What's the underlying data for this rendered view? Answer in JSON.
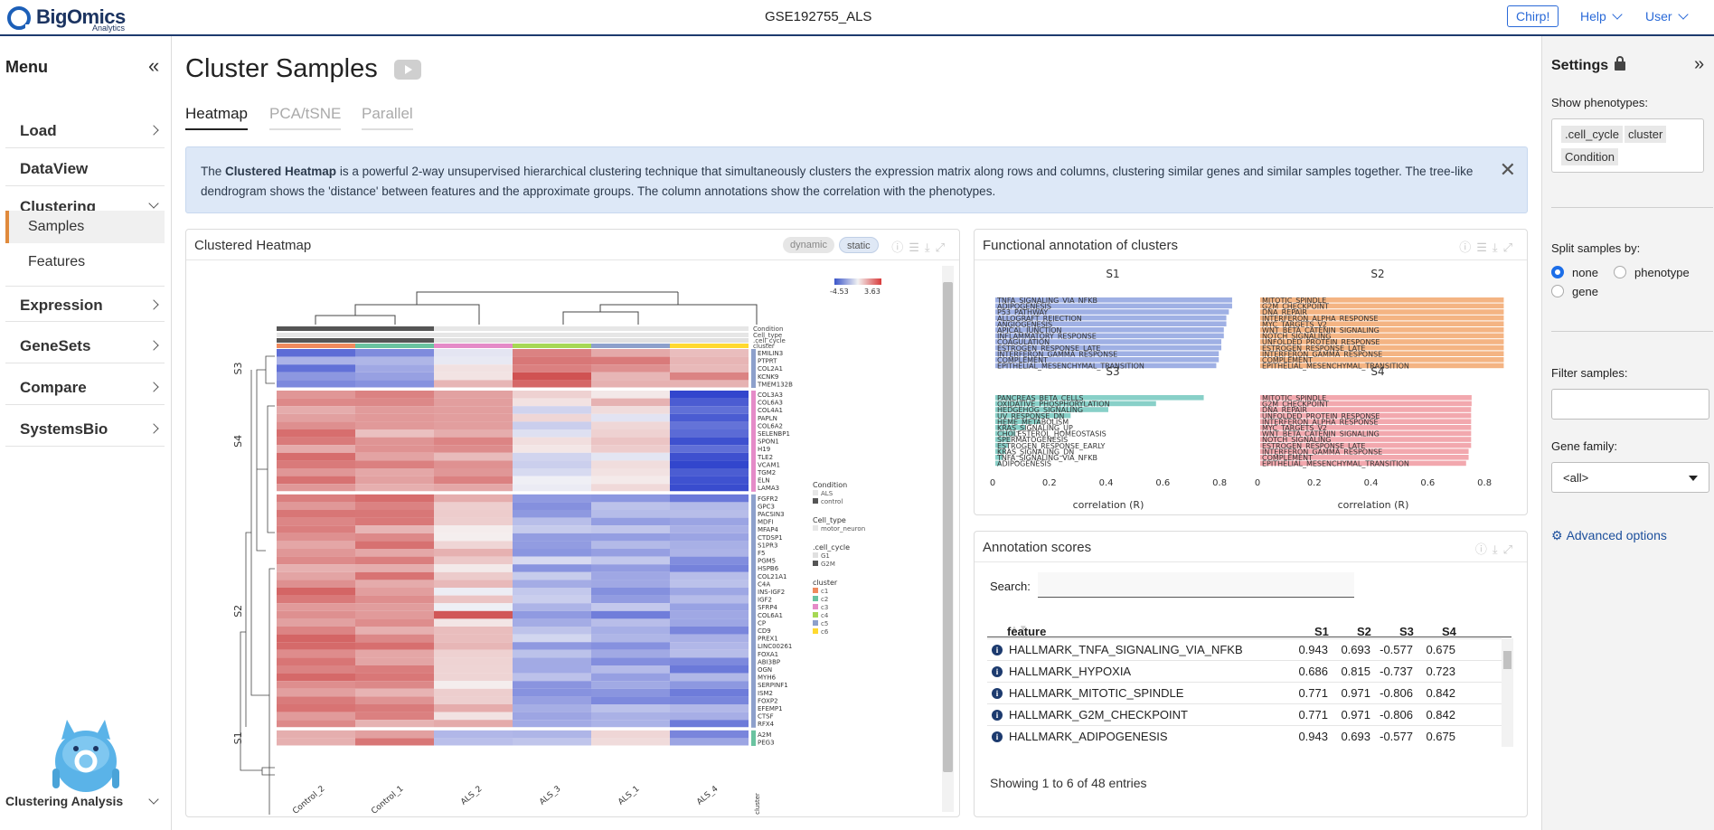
{
  "header": {
    "logo_name": "BigOmics",
    "logo_sub": "Analytics",
    "dataset": "GSE192755_ALS",
    "chirp_label": "Chirp!",
    "help_label": "Help",
    "user_label": "User"
  },
  "sidebar": {
    "title": "Menu",
    "collapse_glyph": "«",
    "items": [
      {
        "label": "Load"
      },
      {
        "label": "DataView"
      },
      {
        "label": "Clustering"
      },
      {
        "label": "Samples"
      },
      {
        "label": "Features"
      },
      {
        "label": "Expression"
      },
      {
        "label": "GeneSets"
      },
      {
        "label": "Compare"
      },
      {
        "label": "SystemsBio"
      }
    ],
    "bottom_label": "Clustering Analysis"
  },
  "main": {
    "title": "Cluster Samples",
    "tabs": [
      "Heatmap",
      "PCA/tSNE",
      "Parallel"
    ],
    "info_pre": "The ",
    "info_bold": "Clustered Heatmap",
    "info_post": " is a powerful 2-way unsupervised hierarchical clustering technique that simultaneously clusters the expression matrix along rows and columns, clustering similar genes and similar samples together. The tree-like dendrogram shows the 'distance' between features and the approximate groups. The column annotations show the correlation with the phenotypes.",
    "close_glyph": "✕"
  },
  "heatmap_card": {
    "title": "Clustered Heatmap",
    "seg_dynamic": "dynamic",
    "seg_static": "static",
    "scale_min": "-4.53",
    "scale_max": "3.63",
    "samples": [
      "Control_2",
      "Control_1",
      "ALS_2",
      "ALS_3",
      "ALS_1",
      "ALS_4"
    ],
    "annot_rows": [
      "Condition",
      "Cell_type",
      ".cell_cycle",
      "cluster"
    ],
    "clusters": [
      "S3",
      "S4",
      "S2",
      "S1"
    ],
    "genes": [
      "EMILIN3",
      "PTPRT",
      "COL2A1",
      "KCNK9",
      "TMEM132B",
      "COL3A3",
      "COL6A3",
      "COL4A1",
      "PAPLN",
      "COL6A2",
      "SELENBP1",
      "SPON1",
      "H19",
      "TLE2",
      "VCAM1",
      "TGM2",
      "ELN",
      "LAMA3",
      "FGFR2",
      "GPC3",
      "PACSIN3",
      "MDFI",
      "MFAP4",
      "CTDSP1",
      "S1PR3",
      "F5",
      "PGM5",
      "HSPB6",
      "COL21A1",
      "C4A",
      "INS-IGF2",
      "IGF2",
      "SFRP4",
      "COL6A1",
      "CP",
      "CD9",
      "PREX1",
      "LINC00261",
      "FOXA1",
      "ABI3BP",
      "OGN",
      "MYH6",
      "SERPINF1",
      "ISM2",
      "FOXP2",
      "EFEMP1",
      "CTSF",
      "RFX4",
      "A2M",
      "PEG3"
    ],
    "col_label": "cluster",
    "legend": {
      "condition_title": "Condition",
      "condition_items": [
        "ALS",
        "control"
      ],
      "celltype_title": "Cell_type",
      "celltype_items": [
        "motor_neuron"
      ],
      "cellcycle_title": ".cell_cycle",
      "cellcycle_items": [
        "G1",
        "G2M"
      ],
      "cluster_title": "cluster",
      "cluster_items": [
        "c1",
        "c2",
        "c3",
        "c4",
        "c5",
        "c6"
      ]
    },
    "cluster_colors": [
      "#f08a5d",
      "#6ac3a0",
      "#e58bc8",
      "#a6d854",
      "#8da0cb",
      "#ffd92f"
    ]
  },
  "functional_card": {
    "title": "Functional annotation of clusters",
    "xlabel": "correlation (R)",
    "ticks": [
      "0",
      "0.2",
      "0.4",
      "0.6",
      "0.8"
    ],
    "panels": [
      {
        "name": "S1",
        "color": "#9fb0e4",
        "terms": [
          "TNFA_SIGNALING_VIA_NFKB",
          "ADIPOGENESIS",
          "P53_PATHWAY",
          "ALLOGRAFT_REJECTION",
          "ANGIOGENESIS",
          "APICAL_JUNCTION",
          "INFLAMMATORY_RESPONSE",
          "COAGULATION",
          "ESTROGEN_RESPONSE_LATE",
          "INTERFERON_GAMMA_RESPONSE",
          "COMPLEMENT",
          "EPITHELIAL_MESENCHYMAL_TRANSITION"
        ],
        "values": [
          0.943,
          0.943,
          0.93,
          0.92,
          0.92,
          0.91,
          0.91,
          0.9,
          0.9,
          0.89,
          0.89,
          0.88
        ]
      },
      {
        "name": "S2",
        "color": "#f4b483",
        "terms": [
          "MITOTIC_SPINDLE",
          "G2M_CHECKPOINT",
          "DNA_REPAIR",
          "INTERFERON_ALPHA_RESPONSE",
          "MYC_TARGETS_V2",
          "WNT_BETA_CATENIN_SIGNALING",
          "NOTCH_SIGNALING",
          "UNFOLDED_PROTEIN_RESPONSE",
          "ESTROGEN_RESPONSE_LATE",
          "INTERFERON_GAMMA_RESPONSE",
          "COMPLEMENT",
          "EPITHELIAL_MESENCHYMAL_TRANSITION"
        ],
        "values": [
          0.971,
          0.971,
          0.97,
          0.97,
          0.97,
          0.97,
          0.97,
          0.97,
          0.97,
          0.97,
          0.97,
          0.97
        ]
      },
      {
        "name": "S3",
        "color": "#88d0c8",
        "terms": [
          "PANCREAS_BETA_CELLS",
          "OXIDATIVE_PHOSPHORYLATION",
          "HEDGEHOG_SIGNALING",
          "UV_RESPONSE_DN",
          "HEME_METABOLISM",
          "KRAS_SIGNALING_UP",
          "CHOLESTEROL_HOMEOSTASIS",
          "SPERMATOGENESIS",
          "ESTROGEN_RESPONSE_EARLY",
          "KRAS_SIGNALING_DN",
          "TNFA_SIGNALING_VIA_NFKB",
          "ADIPOGENESIS"
        ],
        "values": [
          0.83,
          0.64,
          0.45,
          0.3,
          0.18,
          0.12,
          0.08,
          0.06,
          0.05,
          0.04,
          0.03,
          0.02
        ]
      },
      {
        "name": "S4",
        "color": "#f2a8ae",
        "terms": [
          "MITOTIC_SPINDLE",
          "G2M_CHECKPOINT",
          "DNA_REPAIR",
          "UNFOLDED_PROTEIN_RESPONSE",
          "INTERFERON_ALPHA_RESPONSE",
          "MYC_TARGETS_V2",
          "WNT_BETA_CATENIN_SIGNALING",
          "NOTCH_SIGNALING",
          "ESTROGEN_RESPONSE_LATE",
          "INTERFERON_GAMMA_RESPONSE",
          "COMPLEMENT",
          "EPITHELIAL_MESENCHYMAL_TRANSITION"
        ],
        "values": [
          0.842,
          0.842,
          0.84,
          0.84,
          0.84,
          0.84,
          0.84,
          0.84,
          0.84,
          0.83,
          0.83,
          0.82
        ]
      }
    ]
  },
  "scores_card": {
    "title": "Annotation scores",
    "search_label": "Search:",
    "columns": [
      "feature",
      "S1",
      "S2",
      "S3",
      "S4"
    ],
    "rows": [
      [
        "HALLMARK_TNFA_SIGNALING_VIA_NFKB",
        "0.943",
        "0.693",
        "-0.577",
        "0.675"
      ],
      [
        "HALLMARK_HYPOXIA",
        "0.686",
        "0.815",
        "-0.737",
        "0.723"
      ],
      [
        "HALLMARK_MITOTIC_SPINDLE",
        "0.771",
        "0.971",
        "-0.806",
        "0.842"
      ],
      [
        "HALLMARK_G2M_CHECKPOINT",
        "0.771",
        "0.971",
        "-0.806",
        "0.842"
      ],
      [
        "HALLMARK_ADIPOGENESIS",
        "0.943",
        "0.693",
        "-0.577",
        "0.675"
      ]
    ],
    "footer": "Showing 1 to 6 of 48 entries"
  },
  "settings": {
    "title": "Settings",
    "show_phenotypes_label": "Show phenotypes:",
    "phenotype_chips": [
      ".cell_cycle",
      "cluster",
      "Condition"
    ],
    "split_label": "Split samples by:",
    "split_options": [
      "none",
      "phenotype",
      "gene"
    ],
    "split_selected": "none",
    "filter_label": "Filter samples:",
    "gene_family_label": "Gene family:",
    "gene_family_value": "<all>",
    "advanced_label": "Advanced options"
  }
}
